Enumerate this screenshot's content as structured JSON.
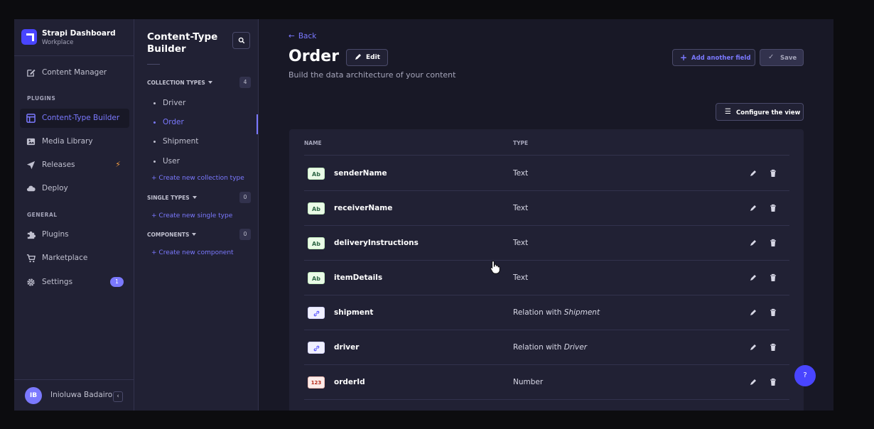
{
  "brand": {
    "name": "Strapi Dashboard",
    "workspace": "Workplace"
  },
  "mainnav": {
    "content_manager": "Content Manager",
    "plugins_heading": "PLUGINS",
    "content_type_builder": "Content-Type Builder",
    "media_library": "Media Library",
    "releases": "Releases",
    "deploy": "Deploy",
    "general_heading": "GENERAL",
    "plugins": "Plugins",
    "marketplace": "Marketplace",
    "settings": "Settings",
    "settings_badge": "1",
    "user_initials": "IB",
    "user_name": "Inioluwa Badairo"
  },
  "subnav": {
    "title": "Content-Type Builder",
    "collection_types": {
      "label": "COLLECTION TYPES",
      "count": "4",
      "items": [
        "Driver",
        "Order",
        "Shipment",
        "User"
      ],
      "create": "Create new collection type"
    },
    "single_types": {
      "label": "SINGLE TYPES",
      "count": "0",
      "create": "Create new single type"
    },
    "components": {
      "label": "COMPONENTS",
      "count": "0",
      "create": "Create new component"
    }
  },
  "header": {
    "back": "Back",
    "title": "Order",
    "edit": "Edit",
    "description": "Build the data architecture of your content",
    "add_field": "Add another field",
    "save": "Save",
    "configure": "Configure the view"
  },
  "table": {
    "col_name": "NAME",
    "col_type": "TYPE",
    "rows": [
      {
        "icon": "Ab",
        "name": "senderName",
        "type": "Text"
      },
      {
        "icon": "Ab",
        "name": "receiverName",
        "type": "Text"
      },
      {
        "icon": "Ab",
        "name": "deliveryInstructions",
        "type": "Text"
      },
      {
        "icon": "Ab",
        "name": "itemDetails",
        "type": "Text"
      },
      {
        "icon": "rel",
        "name": "shipment",
        "type_prefix": "Relation with ",
        "type_target": "Shipment"
      },
      {
        "icon": "rel",
        "name": "driver",
        "type_prefix": "Relation with ",
        "type_target": "Driver"
      },
      {
        "icon": "123",
        "name": "orderId",
        "type": "Number"
      }
    ]
  },
  "help": "?"
}
